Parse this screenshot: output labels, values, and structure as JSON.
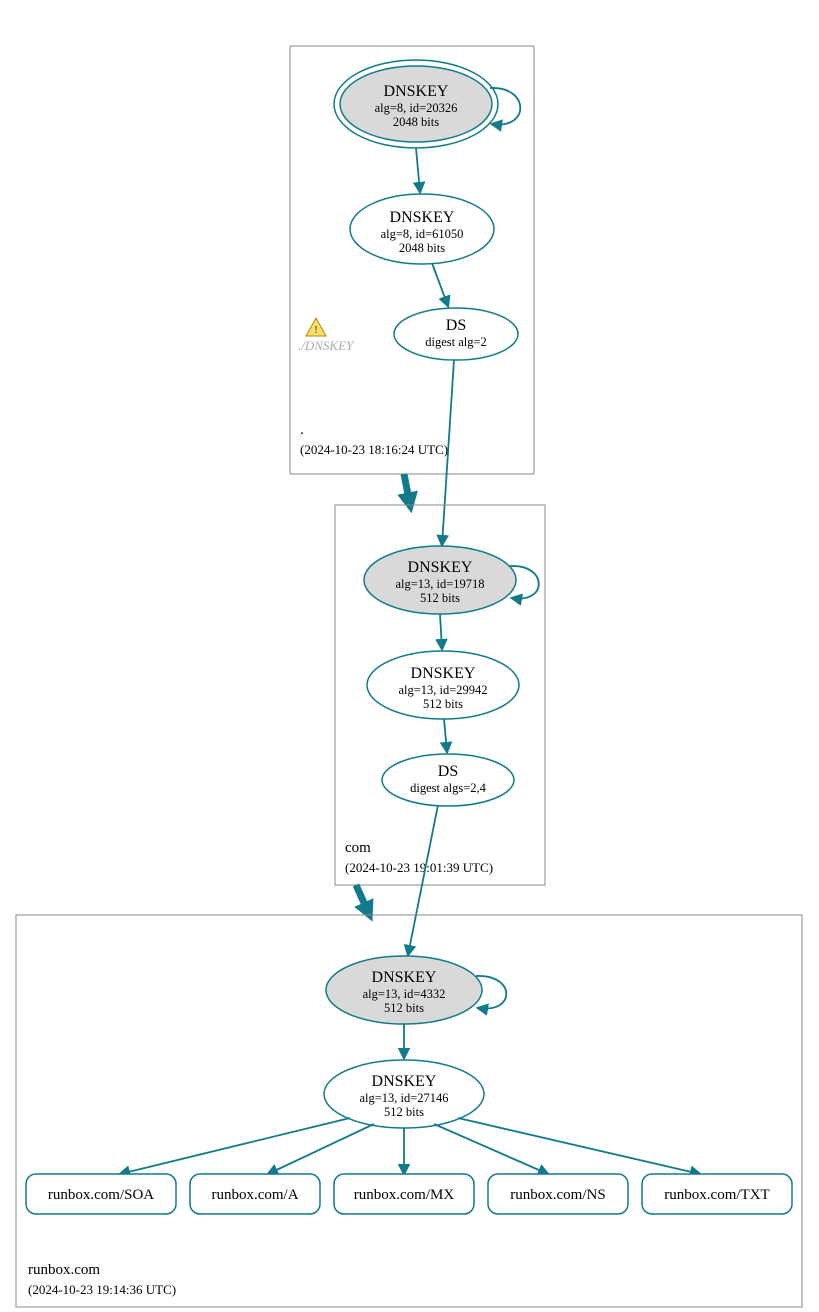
{
  "zones": {
    "root": {
      "name": ".",
      "timestamp": "(2024-10-23 18:16:24 UTC)"
    },
    "com": {
      "name": "com",
      "timestamp": "(2024-10-23 19:01:39 UTC)"
    },
    "runbox": {
      "name": "runbox.com",
      "timestamp": "(2024-10-23 19:14:36 UTC)"
    }
  },
  "nodes": {
    "root_ksk": {
      "title": "DNSKEY",
      "line1": "alg=8, id=20326",
      "line2": "2048 bits"
    },
    "root_zsk": {
      "title": "DNSKEY",
      "line1": "alg=8, id=61050",
      "line2": "2048 bits"
    },
    "root_ds": {
      "title": "DS",
      "line1": "digest alg=2"
    },
    "root_warn": {
      "label": "./DNSKEY"
    },
    "com_ksk": {
      "title": "DNSKEY",
      "line1": "alg=13, id=19718",
      "line2": "512 bits"
    },
    "com_zsk": {
      "title": "DNSKEY",
      "line1": "alg=13, id=29942",
      "line2": "512 bits"
    },
    "com_ds": {
      "title": "DS",
      "line1": "digest algs=2,4"
    },
    "rb_ksk": {
      "title": "DNSKEY",
      "line1": "alg=13, id=4332",
      "line2": "512 bits"
    },
    "rb_zsk": {
      "title": "DNSKEY",
      "line1": "alg=13, id=27146",
      "line2": "512 bits"
    }
  },
  "rrsets": {
    "soa": "runbox.com/SOA",
    "a": "runbox.com/A",
    "mx": "runbox.com/MX",
    "ns": "runbox.com/NS",
    "txt": "runbox.com/TXT"
  },
  "colors": {
    "accent": "#117a8b"
  }
}
